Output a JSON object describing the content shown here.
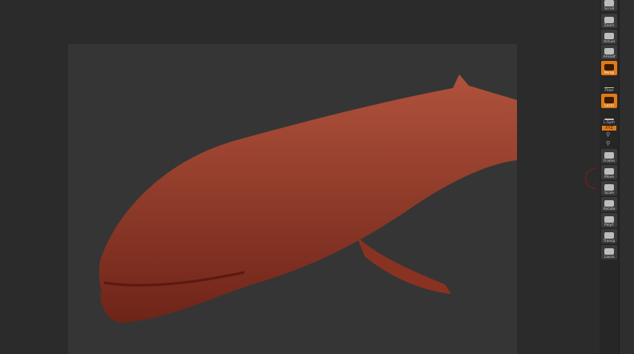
{
  "toolbar": {
    "buttons": [
      {
        "label": "Scroll",
        "active": false
      },
      {
        "label": "Zoom",
        "active": false
      },
      {
        "label": "Actual",
        "active": false
      },
      {
        "label": "AAHalf",
        "active": false
      },
      {
        "label": "Persp",
        "active": true
      },
      {
        "label": "Floor",
        "active": false
      },
      {
        "label": "Local",
        "active": true
      },
      {
        "label": "L.Sym",
        "active": false
      },
      {
        "label": "Frame",
        "active": false
      },
      {
        "label": "Move",
        "active": false
      },
      {
        "label": "Scale",
        "active": false
      },
      {
        "label": "Rotate",
        "active": false
      },
      {
        "label": "PolyF",
        "active": false
      },
      {
        "label": "Transp",
        "active": false
      },
      {
        "label": "Lasso",
        "active": false
      }
    ],
    "xyz_label": "XYZ"
  },
  "colors": {
    "accent": "#e07a18",
    "model": "#8e3424"
  }
}
